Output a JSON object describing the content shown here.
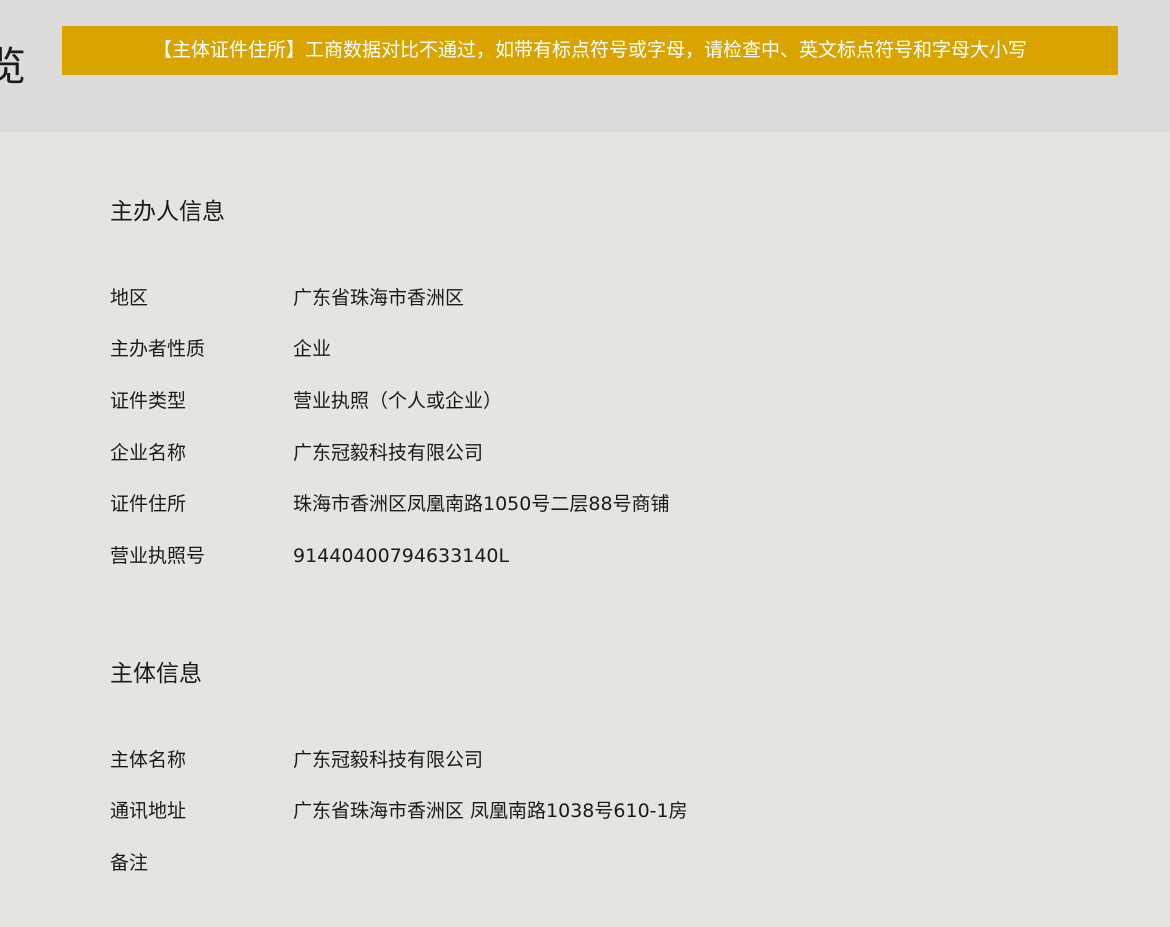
{
  "header": {
    "title_fragment": "览",
    "alert": "【主体证件住所】工商数据对比不通过，如带有标点符号或字母，请检查中、英文标点符号和字母大小写",
    "alert_color": "#d9a400"
  },
  "sponsor": {
    "title": "主办人信息",
    "rows": [
      {
        "label": "地区",
        "value": "广东省珠海市香洲区"
      },
      {
        "label": "主办者性质",
        "value": "企业"
      },
      {
        "label": "证件类型",
        "value": "营业执照（个人或企业）"
      },
      {
        "label": "企业名称",
        "value": "广东冠毅科技有限公司"
      },
      {
        "label": "证件住所",
        "value": "珠海市香洲区凤凰南路1050号二层88号商铺"
      },
      {
        "label": "营业执照号",
        "value": "91440400794633140L"
      }
    ]
  },
  "entity": {
    "title": "主体信息",
    "rows": [
      {
        "label": "主体名称",
        "value": "广东冠毅科技有限公司"
      },
      {
        "label": "通讯地址",
        "value": "广东省珠海市香洲区 凤凰南路1038号610-1房"
      },
      {
        "label": "备注",
        "value": ""
      }
    ]
  }
}
